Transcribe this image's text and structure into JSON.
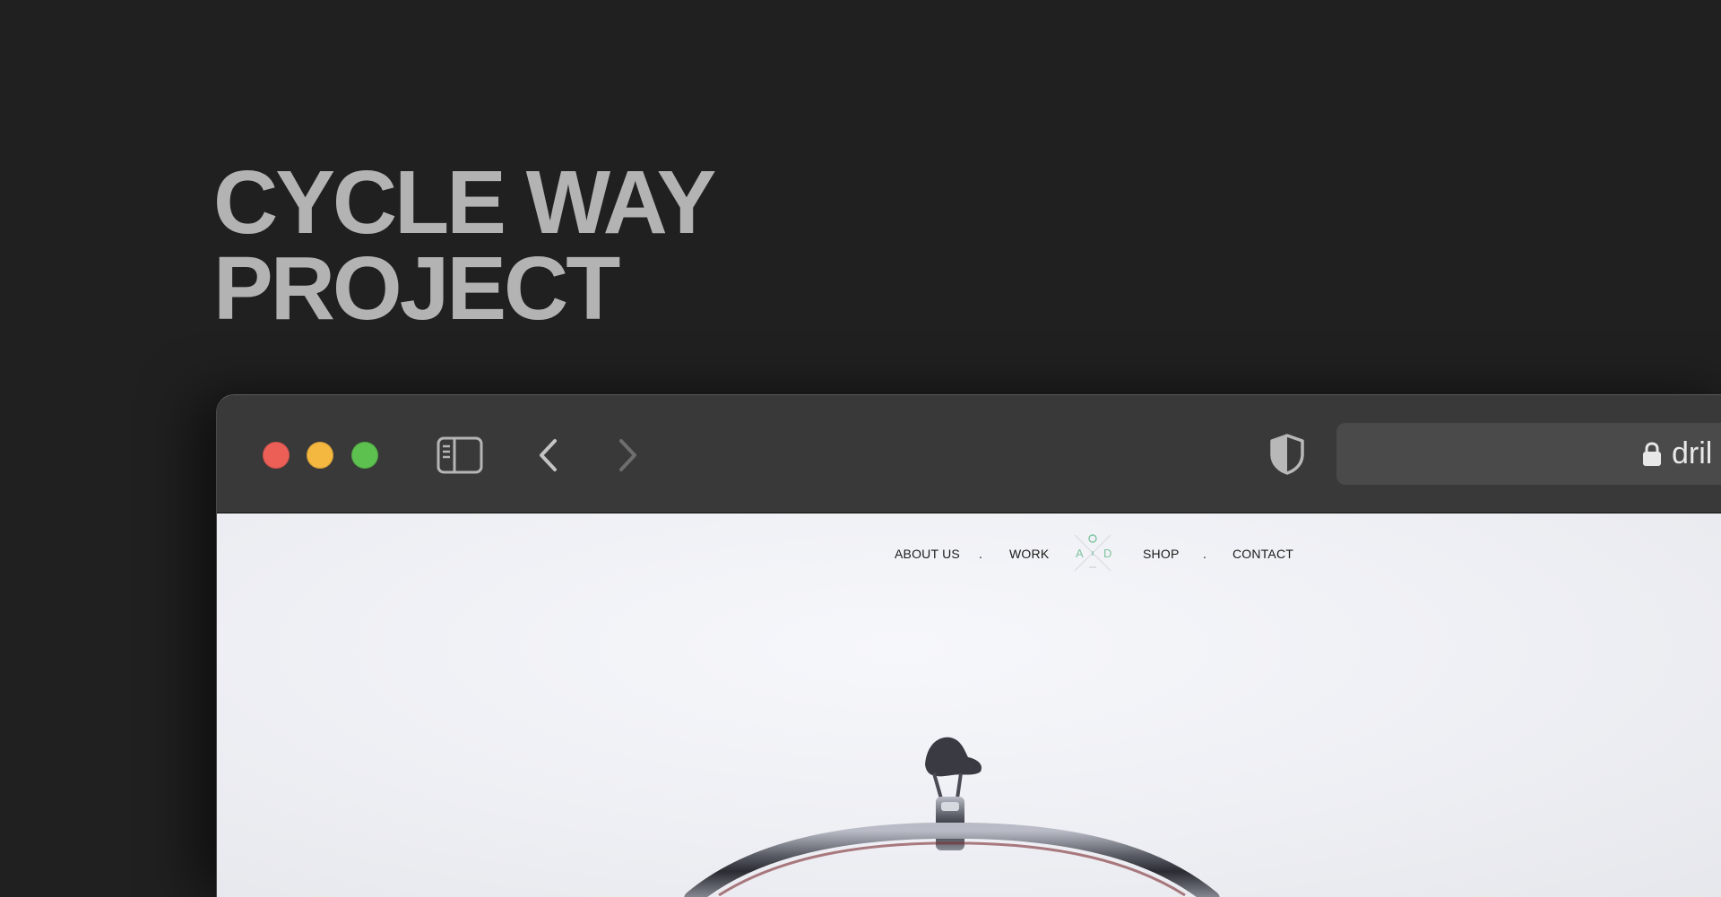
{
  "page": {
    "title_lines": [
      "CYCLE WAY",
      "PROJECT"
    ]
  },
  "browser": {
    "traffic_lights": [
      "close",
      "minimize",
      "zoom"
    ],
    "toolbar_icons": [
      "sidebar-toggle-icon",
      "back-arrow-icon",
      "forward-arrow-icon",
      "privacy-shield-icon"
    ],
    "address_bar": {
      "icon": "lock-icon",
      "url_visible": "dril"
    }
  },
  "site": {
    "nav": {
      "about": "ABOUT US",
      "separator_1": ".",
      "work": "WORK",
      "logo_letters": [
        "A",
        "O",
        "D"
      ],
      "shop": "SHOP",
      "separator_2": ".",
      "contact": "CONTACT"
    },
    "hero_image": "bicycle-handlebar-and-saddle"
  },
  "colors": {
    "background": "#202020",
    "title": "#b3b3b3",
    "toolbar": "#393939",
    "address_bar": "#4a4a4a",
    "traffic_close": "#ec5f57",
    "traffic_minimize": "#f4b73f",
    "traffic_zoom": "#5cc14e",
    "logo_accent": "#7fc4a0",
    "page_background": "#f1f2f6"
  }
}
